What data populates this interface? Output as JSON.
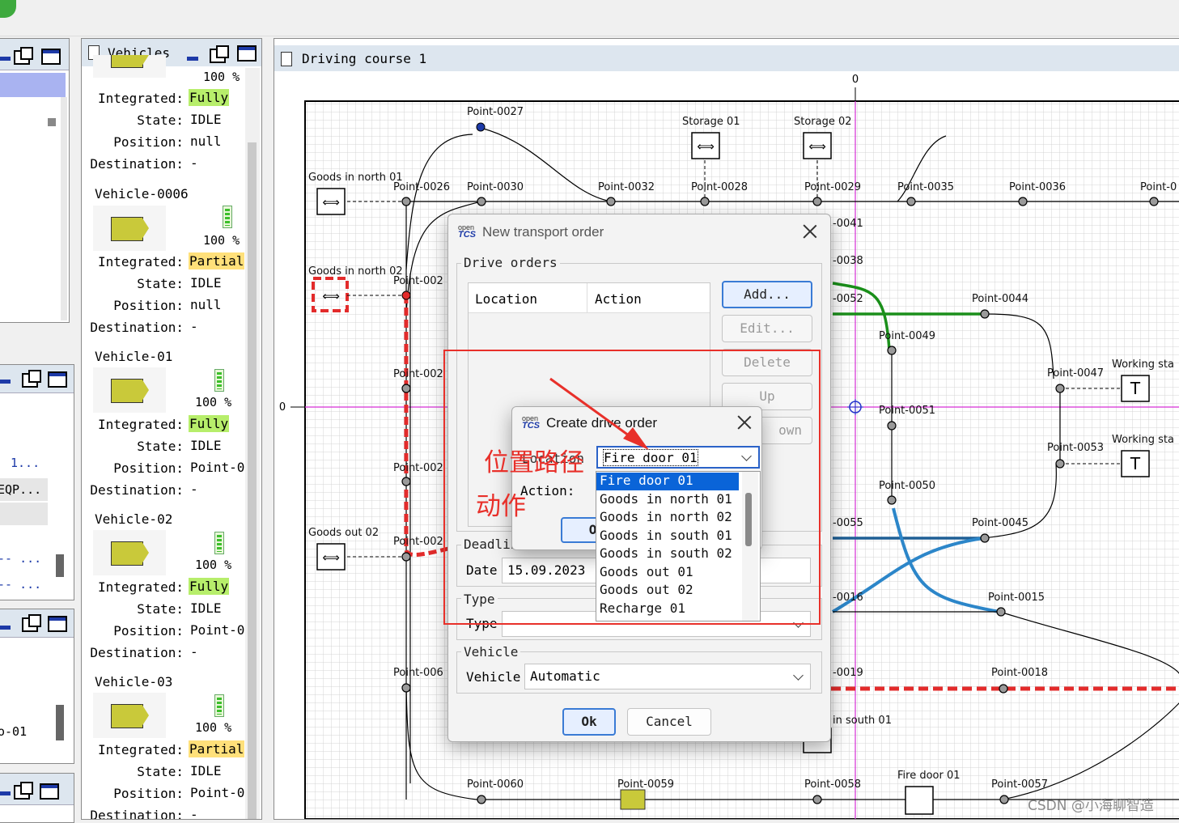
{
  "drawing_view": {
    "title": "Driving course 1",
    "ruler_x_zero": "0",
    "ruler_y_zero": "0",
    "points": [
      {
        "label": "Point-0027"
      },
      {
        "label": "Point-0026"
      },
      {
        "label": "Point-0030"
      },
      {
        "label": "Point-0032"
      },
      {
        "label": "Point-0028"
      },
      {
        "label": "Point-0029"
      },
      {
        "label": "Point-0035"
      },
      {
        "label": "Point-0036"
      },
      {
        "label": "Point-0"
      },
      {
        "label": "Point-002"
      },
      {
        "label": "Point-002"
      },
      {
        "label": "Point-002"
      },
      {
        "label": "Point-002"
      },
      {
        "label": "Point-006"
      },
      {
        "label": "Point-0060"
      },
      {
        "label": "Point-0059"
      },
      {
        "label": "Point-0058"
      },
      {
        "label": "Point-0057"
      },
      {
        "label": "Point-0044"
      },
      {
        "label": "Point-0049"
      },
      {
        "label": "Point-0047"
      },
      {
        "label": "Point-0051"
      },
      {
        "label": "Point-0053"
      },
      {
        "label": "Point-0050"
      },
      {
        "label": "Point-0045"
      },
      {
        "label": "Point-0015"
      },
      {
        "label": "Point-0018"
      },
      {
        "label": "-0041"
      },
      {
        "label": "-0038"
      },
      {
        "label": "-0052"
      },
      {
        "label": "-0055"
      },
      {
        "label": "-0016"
      },
      {
        "label": "-0019"
      }
    ],
    "locations": [
      {
        "label": "Storage 01"
      },
      {
        "label": "Storage 02"
      },
      {
        "label": "Goods in north 01"
      },
      {
        "label": "Goods in north 02"
      },
      {
        "label": "Goods out 02"
      },
      {
        "label": "Working sta"
      },
      {
        "label": "Working sta"
      },
      {
        "label": "in south 01"
      },
      {
        "label": "Fire door 01"
      }
    ]
  },
  "vehicles_panel": {
    "title": "Vehicles",
    "labels": {
      "integrated": "Integrated:",
      "state": "State:",
      "position": "Position:",
      "destination": "Destination:"
    },
    "vehicles": [
      {
        "name": "",
        "battery": "100 %",
        "integrated": "Fully",
        "state": "IDLE",
        "position": "null",
        "destination": "-"
      },
      {
        "name": "Vehicle-0006",
        "battery": "100 %",
        "integrated": "Partial",
        "state": "IDLE",
        "position": "null",
        "destination": "-"
      },
      {
        "name": "Vehicle-01",
        "battery": "100 %",
        "integrated": "Fully",
        "state": "IDLE",
        "position": "Point-0",
        "destination": "-"
      },
      {
        "name": "Vehicle-02",
        "battery": "100 %",
        "integrated": "Fully",
        "state": "IDLE",
        "position": "Point-0",
        "destination": "-"
      },
      {
        "name": "Vehicle-03",
        "battery": "100 %",
        "integrated": "Partial",
        "state": "IDLE",
        "position": "Point-0",
        "destination": "-"
      }
    ]
  },
  "left_list": {
    "items": [
      "1...",
      "EQP...",
      "-- ...",
      "-- ...",
      "o-01"
    ]
  },
  "transport_dialog": {
    "logo_top": "open",
    "logo_bottom": "TCS",
    "title": "New transport order",
    "drive_orders_label": "Drive orders",
    "columns": [
      "Location",
      "Action"
    ],
    "buttons": {
      "add": "Add...",
      "edit": "Edit...",
      "delete": "Delete",
      "up": "Up",
      "down": "own"
    },
    "deadline_label": "Deadlin",
    "date_label": "Date",
    "date_value": "15.09.2023",
    "type_group_label": "Type",
    "type_label": "Type",
    "type_value": "-",
    "vehicle_group_label": "Vehicle",
    "vehicle_label": "Vehicle",
    "vehicle_value": "Automatic",
    "ok": "Ok",
    "cancel": "Cancel"
  },
  "drive_order_dialog": {
    "logo_top": "open",
    "logo_bottom": "TCS",
    "title": "Create drive order",
    "location_label": "Location",
    "action_label": "Action:",
    "ok": "Ok",
    "selected_location": "Fire door 01",
    "options": [
      "Fire door 01",
      "Goods in north 01",
      "Goods in north 02",
      "Goods in south 01",
      "Goods in south 02",
      "Goods out 01",
      "Goods out 02",
      "Recharge 01"
    ]
  },
  "annotation": {
    "line1": "位置路径",
    "line2": "动作",
    "color": "#e8302a"
  },
  "watermark": "CSDN @小海聊智造",
  "colors": {
    "highlight_route": "#e32b2b",
    "green_route": "#1a8f1a",
    "blue_route": "#2c86c9",
    "selected_option": "#0a64d8"
  }
}
